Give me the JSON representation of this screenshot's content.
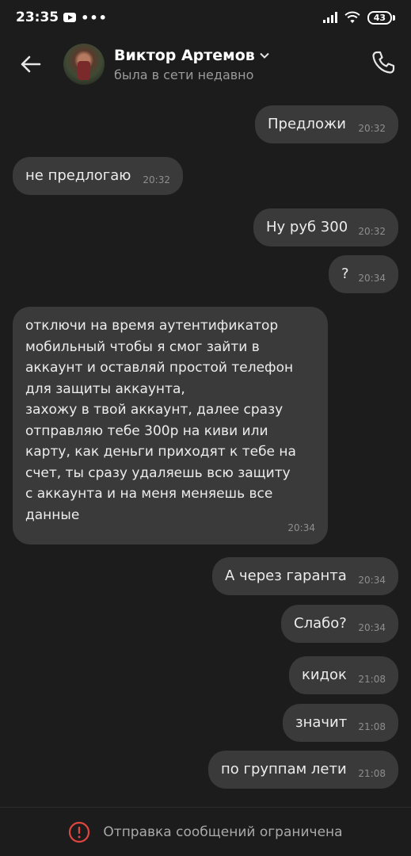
{
  "status_bar": {
    "time": "23:35",
    "dots": "•••",
    "battery": "43"
  },
  "header": {
    "name": "Виктор Артемов",
    "status": "была в сети недавно"
  },
  "messages": [
    {
      "text": "Предложи",
      "time": "20:32"
    },
    {
      "text": "не предлогаю",
      "time": "20:32"
    },
    {
      "text": "Ну руб 300",
      "time": "20:32"
    },
    {
      "text": "?",
      "time": "20:34"
    },
    {
      "text": "отключи на время аутентификатор\nмобильный чтобы я смог зайти в\nаккаунт и оставляй простой телефон\nдля защиты аккаунта,\nзахожу в твой аккаунт, далее сразу\nотправляю тебе 300р на киви или\nкарту, как деньги приходят к тебе на\nсчет, ты сразу удаляешь всю защиту\nс аккаунта и на меня меняешь все\nданные",
      "time": "20:34"
    },
    {
      "text": "А через гаранта",
      "time": "20:34"
    },
    {
      "text": "Слабо?",
      "time": "20:34"
    },
    {
      "text": "кидок",
      "time": "21:08"
    },
    {
      "text": "значит",
      "time": "21:08"
    },
    {
      "text": "по группам лети",
      "time": "21:08"
    }
  ],
  "footer": {
    "text": "Отправка сообщений ограничена"
  },
  "colors": {
    "background": "#1c1c1c",
    "bubble": "#3a3a3a",
    "warning": "#e0463f"
  }
}
